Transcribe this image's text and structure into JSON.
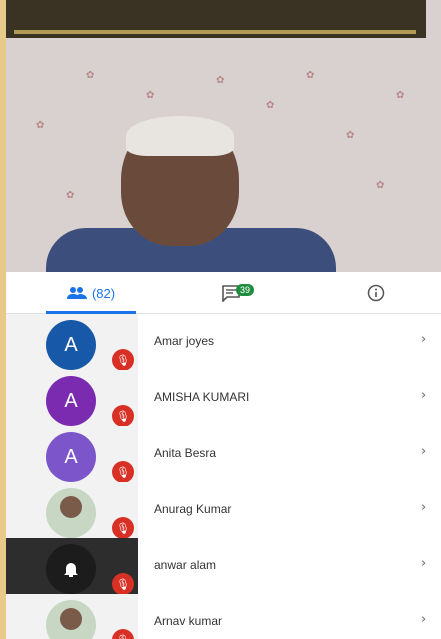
{
  "tabs": {
    "people_count": "(82)",
    "chat_badge": "39"
  },
  "participants": [
    {
      "name": "Amar joyes",
      "avatar": "A",
      "color": "#1759a8"
    },
    {
      "name": "AMISHA KUMARI",
      "avatar": "A",
      "color": "#7b2bb0"
    },
    {
      "name": "Anita Besra",
      "avatar": "A",
      "color": "#7b55c9"
    },
    {
      "name": "Anurag Kumar",
      "avatar": "",
      "color": "#c8d6c4"
    },
    {
      "name": "anwar alam",
      "avatar": "",
      "color": "#1c1c1c"
    },
    {
      "name": "Arnav kumar",
      "avatar": "",
      "color": "#c8d6c4"
    }
  ],
  "icons": {
    "people": "people-icon",
    "chat": "chat-icon",
    "info": "info-icon",
    "mic_off": "mic-off-icon",
    "chevron": "chevron-right-icon"
  }
}
